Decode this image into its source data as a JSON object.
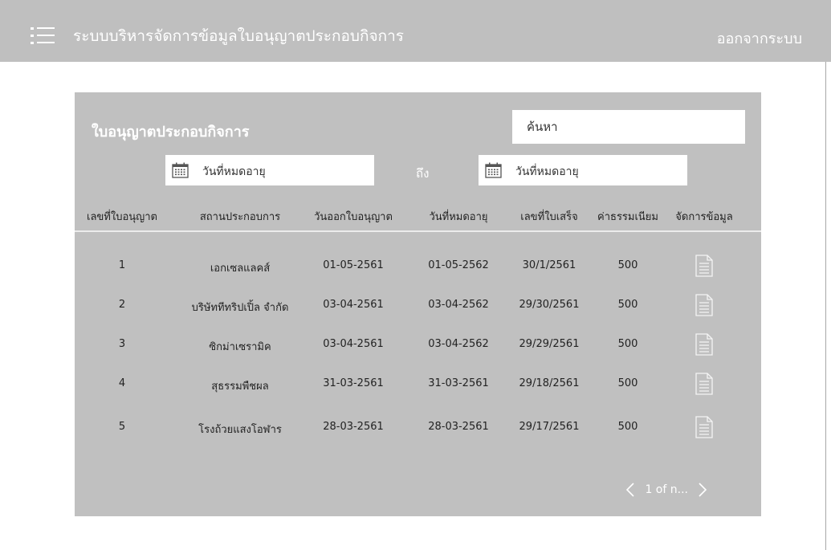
{
  "header": {
    "title": "ระบบบริหารจัดการข้อมูลใบอนุญาตประกอบกิจการ",
    "logout_label": "ออกจากระบบ"
  },
  "card": {
    "title": "ใบอนุญาตประกอบกิจการ",
    "search_placeholder": "ค้นหา",
    "date_from_placeholder": "วันที่หมดอายุ",
    "date_to_label": "ถึง",
    "date_to_placeholder": "วันที่หมดอายุ"
  },
  "table": {
    "columns": [
      "เลขที่ใบอนุญาต",
      "สถานประกอบการ",
      "วันออกใบอนุญาต",
      "วันที่หมดอายุ",
      "เลขที่ใบเสร็จ",
      "ค่าธรรมเนียม",
      "จัดการข้อมูล"
    ],
    "rows": [
      {
        "no": "1",
        "business": "เอกเซลแลคส์",
        "issue_date": "01-05-2561",
        "expiry_date": "01-05-2562",
        "receipt": "30/1/2561",
        "fee": "500"
      },
      {
        "no": "2",
        "business": "บริษัททีทริปเปิ้ล จำกัด",
        "issue_date": "03-04-2561",
        "expiry_date": "03-04-2562",
        "receipt": "29/30/2561",
        "fee": "500"
      },
      {
        "no": "3",
        "business": "ซิกม่าเซรามิค",
        "issue_date": "03-04-2561",
        "expiry_date": "03-04-2562",
        "receipt": "29/29/2561",
        "fee": "500"
      },
      {
        "no": "4",
        "business": "สุธรรมพืชผล",
        "issue_date": "31-03-2561",
        "expiry_date": "31-03-2561",
        "receipt": "29/18/2561",
        "fee": "500"
      },
      {
        "no": "5",
        "business": "โรงถ้วยแสงโอฬาร",
        "issue_date": "28-03-2561",
        "expiry_date": "28-03-2561",
        "receipt": "29/17/2561",
        "fee": "500"
      }
    ]
  },
  "pagination": {
    "label": "1 of n..."
  },
  "icons": {
    "menu": "hamburger-menu-icon",
    "calendar": "calendar-icon",
    "document": "document-icon",
    "prev": "chevron-left-icon",
    "next": "chevron-right-icon"
  },
  "colors": {
    "topbar": "#bfbfbf",
    "card": "#c0c0c0",
    "text_on_gray": "#ffffff"
  }
}
